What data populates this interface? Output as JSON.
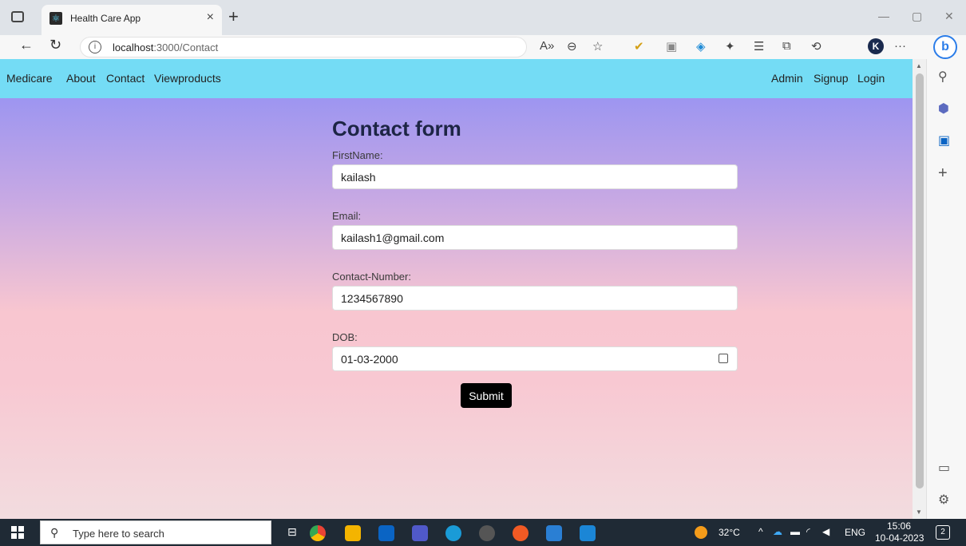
{
  "browser": {
    "tab_title": "Health Care App",
    "tab_close": "×",
    "new_tab": "+",
    "url_host": "localhost",
    "url_path": ":3000/Contact",
    "profile_initial": "K",
    "bing_label": "b",
    "more_label": "···"
  },
  "navbar": {
    "brand": "Medicare",
    "left_links": [
      "About",
      "Contact",
      "Viewproducts"
    ],
    "right_links": [
      "Admin",
      "Signup",
      "Login"
    ]
  },
  "form": {
    "title": "Contact form",
    "fields": [
      {
        "label": "FirstName:",
        "value": "kailash"
      },
      {
        "label": "Email:",
        "value": "kailash1@gmail.com"
      },
      {
        "label": "Contact-Number:",
        "value": "1234567890"
      },
      {
        "label": "DOB:",
        "value": "01-03-2000"
      }
    ],
    "submit_label": "Submit"
  },
  "taskbar": {
    "search_placeholder": "Type here to search",
    "temperature": "32°C",
    "language": "ENG",
    "time": "15:06",
    "date": "10-04-2023",
    "notification_count": "2"
  },
  "colors": {
    "navbar": "#74dcf5",
    "gradient_top": "#8d8ef5",
    "gradient_bottom": "#f2dcdf",
    "button": "#000000"
  }
}
